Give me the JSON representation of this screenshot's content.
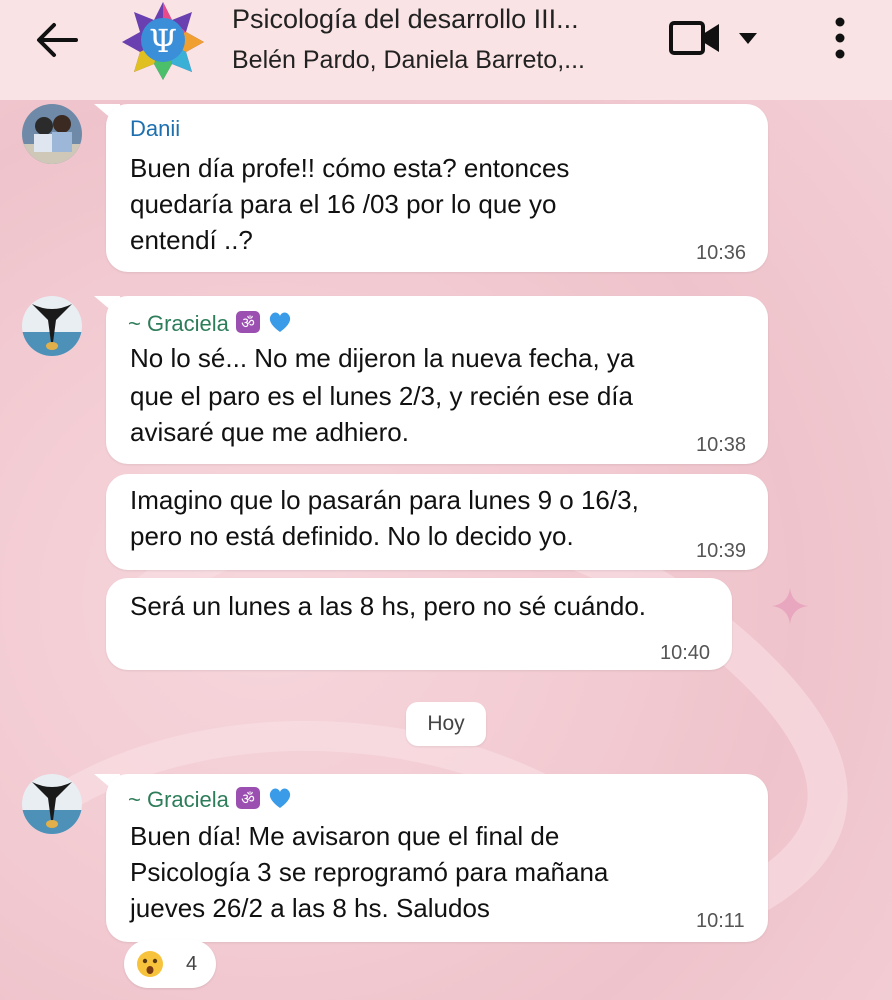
{
  "header": {
    "title": "Psicología del desarrollo III...",
    "subtitle": "Belén Pardo, Daniela Barreto,..."
  },
  "messages": [
    {
      "sender": "Danii",
      "lines": [
        "Buen día profe!! cómo esta? entonces",
        "quedaría para el 16 /03 por lo que yo",
        "entendí ..?"
      ],
      "time": "10:36"
    },
    {
      "sender": "~ Graciela",
      "lines": [
        "No lo sé... No me dijeron la nueva fecha, ya",
        "que el paro es el lunes 2/3, y recién ese día",
        "avisaré que me adhiero."
      ],
      "time": "10:38"
    },
    {
      "lines": [
        "Imagino que lo pasarán para lunes 9 o 16/3,",
        "pero no está definido. No lo decido yo."
      ],
      "time": "10:39"
    },
    {
      "lines": [
        "Será un lunes a las 8 hs, pero no sé cuándo."
      ],
      "time": "10:40"
    },
    {
      "sender": "~ Graciela",
      "lines": [
        "Buen día! Me avisaron que el final de",
        "Psicología 3 se reprogramó para mañana",
        "jueves 26/2 a las 8 hs. Saludos"
      ],
      "time": "10:11"
    }
  ],
  "day_separator": "Hoy",
  "reaction": {
    "emoji": "astonished-face",
    "count": "4"
  },
  "icons": [
    "back-arrow-icon",
    "video-call-icon",
    "chevron-down-icon",
    "more-options-icon",
    "om-emoji-icon",
    "blue-heart-icon",
    "sparkle-icon"
  ],
  "colors": {
    "header_bg": "#fae3e4",
    "bubble_bg": "#ffffff",
    "sender_blue": "#1d6fb0",
    "sender_green": "#2e7d5a"
  }
}
